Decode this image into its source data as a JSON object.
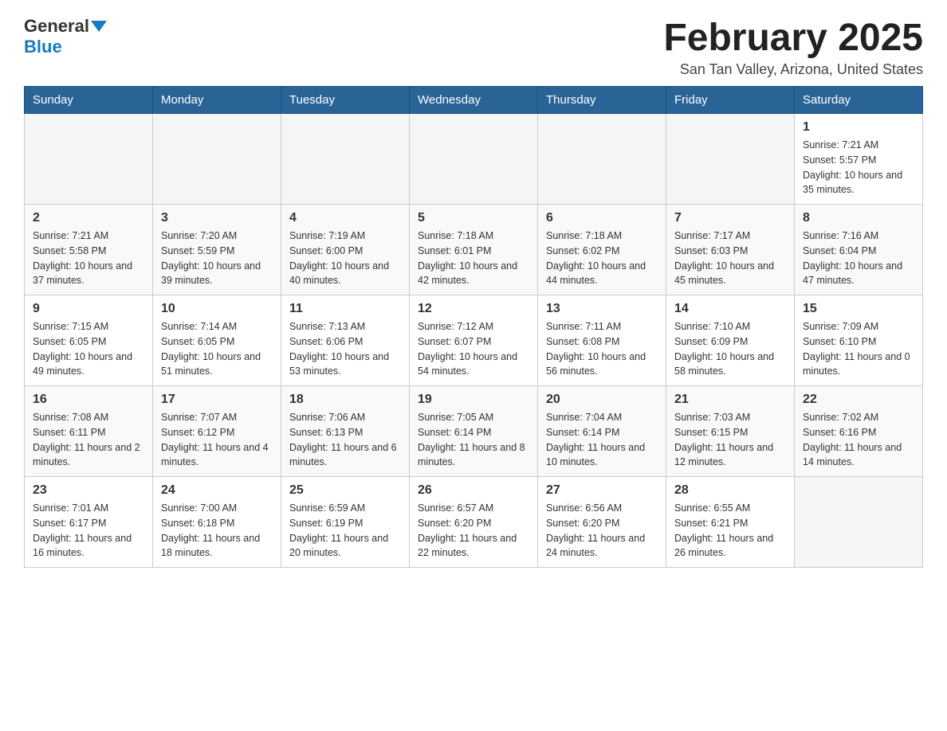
{
  "header": {
    "logo_general": "General",
    "logo_blue": "Blue",
    "month_title": "February 2025",
    "location": "San Tan Valley, Arizona, United States"
  },
  "weekdays": [
    "Sunday",
    "Monday",
    "Tuesday",
    "Wednesday",
    "Thursday",
    "Friday",
    "Saturday"
  ],
  "weeks": [
    [
      {
        "day": "",
        "info": ""
      },
      {
        "day": "",
        "info": ""
      },
      {
        "day": "",
        "info": ""
      },
      {
        "day": "",
        "info": ""
      },
      {
        "day": "",
        "info": ""
      },
      {
        "day": "",
        "info": ""
      },
      {
        "day": "1",
        "info": "Sunrise: 7:21 AM\nSunset: 5:57 PM\nDaylight: 10 hours and 35 minutes."
      }
    ],
    [
      {
        "day": "2",
        "info": "Sunrise: 7:21 AM\nSunset: 5:58 PM\nDaylight: 10 hours and 37 minutes."
      },
      {
        "day": "3",
        "info": "Sunrise: 7:20 AM\nSunset: 5:59 PM\nDaylight: 10 hours and 39 minutes."
      },
      {
        "day": "4",
        "info": "Sunrise: 7:19 AM\nSunset: 6:00 PM\nDaylight: 10 hours and 40 minutes."
      },
      {
        "day": "5",
        "info": "Sunrise: 7:18 AM\nSunset: 6:01 PM\nDaylight: 10 hours and 42 minutes."
      },
      {
        "day": "6",
        "info": "Sunrise: 7:18 AM\nSunset: 6:02 PM\nDaylight: 10 hours and 44 minutes."
      },
      {
        "day": "7",
        "info": "Sunrise: 7:17 AM\nSunset: 6:03 PM\nDaylight: 10 hours and 45 minutes."
      },
      {
        "day": "8",
        "info": "Sunrise: 7:16 AM\nSunset: 6:04 PM\nDaylight: 10 hours and 47 minutes."
      }
    ],
    [
      {
        "day": "9",
        "info": "Sunrise: 7:15 AM\nSunset: 6:05 PM\nDaylight: 10 hours and 49 minutes."
      },
      {
        "day": "10",
        "info": "Sunrise: 7:14 AM\nSunset: 6:05 PM\nDaylight: 10 hours and 51 minutes."
      },
      {
        "day": "11",
        "info": "Sunrise: 7:13 AM\nSunset: 6:06 PM\nDaylight: 10 hours and 53 minutes."
      },
      {
        "day": "12",
        "info": "Sunrise: 7:12 AM\nSunset: 6:07 PM\nDaylight: 10 hours and 54 minutes."
      },
      {
        "day": "13",
        "info": "Sunrise: 7:11 AM\nSunset: 6:08 PM\nDaylight: 10 hours and 56 minutes."
      },
      {
        "day": "14",
        "info": "Sunrise: 7:10 AM\nSunset: 6:09 PM\nDaylight: 10 hours and 58 minutes."
      },
      {
        "day": "15",
        "info": "Sunrise: 7:09 AM\nSunset: 6:10 PM\nDaylight: 11 hours and 0 minutes."
      }
    ],
    [
      {
        "day": "16",
        "info": "Sunrise: 7:08 AM\nSunset: 6:11 PM\nDaylight: 11 hours and 2 minutes."
      },
      {
        "day": "17",
        "info": "Sunrise: 7:07 AM\nSunset: 6:12 PM\nDaylight: 11 hours and 4 minutes."
      },
      {
        "day": "18",
        "info": "Sunrise: 7:06 AM\nSunset: 6:13 PM\nDaylight: 11 hours and 6 minutes."
      },
      {
        "day": "19",
        "info": "Sunrise: 7:05 AM\nSunset: 6:14 PM\nDaylight: 11 hours and 8 minutes."
      },
      {
        "day": "20",
        "info": "Sunrise: 7:04 AM\nSunset: 6:14 PM\nDaylight: 11 hours and 10 minutes."
      },
      {
        "day": "21",
        "info": "Sunrise: 7:03 AM\nSunset: 6:15 PM\nDaylight: 11 hours and 12 minutes."
      },
      {
        "day": "22",
        "info": "Sunrise: 7:02 AM\nSunset: 6:16 PM\nDaylight: 11 hours and 14 minutes."
      }
    ],
    [
      {
        "day": "23",
        "info": "Sunrise: 7:01 AM\nSunset: 6:17 PM\nDaylight: 11 hours and 16 minutes."
      },
      {
        "day": "24",
        "info": "Sunrise: 7:00 AM\nSunset: 6:18 PM\nDaylight: 11 hours and 18 minutes."
      },
      {
        "day": "25",
        "info": "Sunrise: 6:59 AM\nSunset: 6:19 PM\nDaylight: 11 hours and 20 minutes."
      },
      {
        "day": "26",
        "info": "Sunrise: 6:57 AM\nSunset: 6:20 PM\nDaylight: 11 hours and 22 minutes."
      },
      {
        "day": "27",
        "info": "Sunrise: 6:56 AM\nSunset: 6:20 PM\nDaylight: 11 hours and 24 minutes."
      },
      {
        "day": "28",
        "info": "Sunrise: 6:55 AM\nSunset: 6:21 PM\nDaylight: 11 hours and 26 minutes."
      },
      {
        "day": "",
        "info": ""
      }
    ]
  ]
}
